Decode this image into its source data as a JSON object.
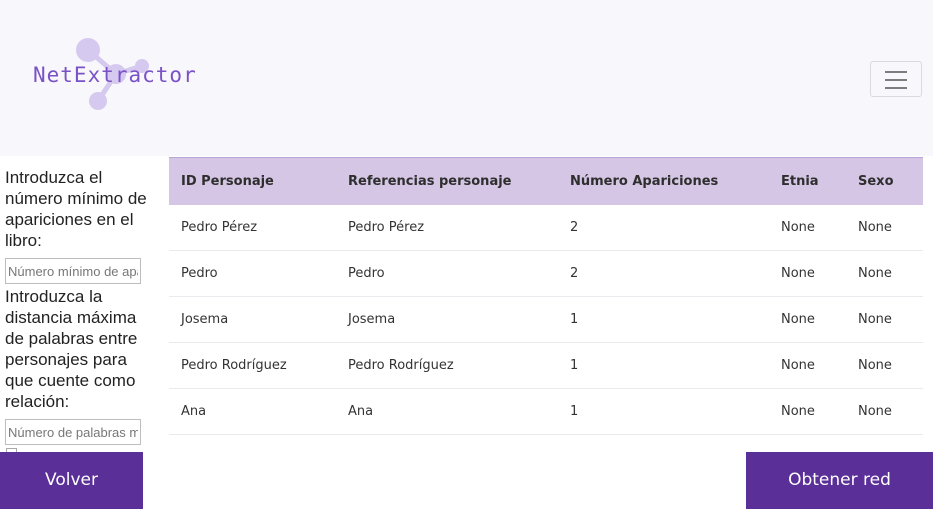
{
  "header": {
    "logo_text": "NetExtractor",
    "menu_icon": "hamburger-icon"
  },
  "sidebar": {
    "min_appearances_label": "Introduzca el número mínimo de apariciones en el libro:",
    "min_appearances_placeholder": "Número mínimo de apariciones",
    "max_distance_label": "Introduzca la distancia máxima de palabras entre personajes para que cuente como relación:",
    "max_distance_placeholder": "Número de palabras máximo"
  },
  "table": {
    "headers": [
      "ID Personaje",
      "Referencias personaje",
      "Número Apariciones",
      "Etnia",
      "Sexo"
    ],
    "rows": [
      [
        "Pedro Pérez",
        "Pedro Pérez",
        "2",
        "None",
        "None"
      ],
      [
        "Pedro",
        "Pedro",
        "2",
        "None",
        "None"
      ],
      [
        "Josema",
        "Josema",
        "1",
        "None",
        "None"
      ],
      [
        "Pedro Rodríguez",
        "Pedro Rodríguez",
        "1",
        "None",
        "None"
      ],
      [
        "Ana",
        "Ana",
        "1",
        "None",
        "None"
      ]
    ]
  },
  "buttons": {
    "back_label": "Volver",
    "get_network_label": "Obtener red"
  },
  "colors": {
    "accent": "#5a2f98",
    "table_header": "#d4c6e4",
    "logo": "#7a52c7"
  }
}
